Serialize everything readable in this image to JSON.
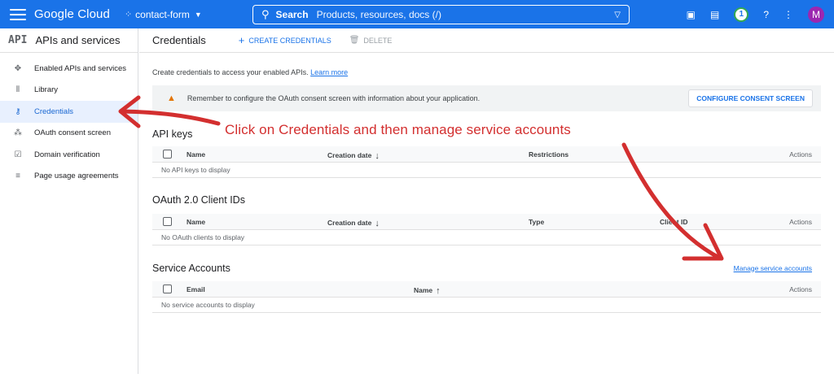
{
  "topbar": {
    "brand": "Google Cloud",
    "project": "contact-form",
    "search_label": "Search",
    "search_placeholder": "Products, resources, docs (/)",
    "notification_count": "1",
    "avatar_letter": "M"
  },
  "sidebar": {
    "badge": "API",
    "title": "APIs and services",
    "items": [
      {
        "label": "Enabled APIs and services"
      },
      {
        "label": "Library"
      },
      {
        "label": "Credentials"
      },
      {
        "label": "OAuth consent screen"
      },
      {
        "label": "Domain verification"
      },
      {
        "label": "Page usage agreements"
      }
    ]
  },
  "header": {
    "title": "Credentials",
    "create_label": "CREATE CREDENTIALS",
    "delete_label": "DELETE"
  },
  "intro": {
    "text": "Create credentials to access your enabled APIs.",
    "link": "Learn more"
  },
  "warning": {
    "text": "Remember to configure the OAuth consent screen with information about your application.",
    "button": "CONFIGURE CONSENT SCREEN"
  },
  "api_keys": {
    "title": "API keys",
    "columns": [
      "Name",
      "Creation date",
      "Restrictions",
      "Actions"
    ],
    "empty": "No API keys to display"
  },
  "oauth": {
    "title": "OAuth 2.0 Client IDs",
    "columns": [
      "Name",
      "Creation date",
      "Type",
      "Client ID",
      "Actions"
    ],
    "empty": "No OAuth clients to display"
  },
  "service_accounts": {
    "title": "Service Accounts",
    "manage_link": "Manage service accounts",
    "columns": [
      "Email",
      "Name",
      "Actions"
    ],
    "empty": "No service accounts to display"
  },
  "annotation": {
    "text": "Click on Credentials and then manage service accounts",
    "color": "#d32f2f"
  }
}
